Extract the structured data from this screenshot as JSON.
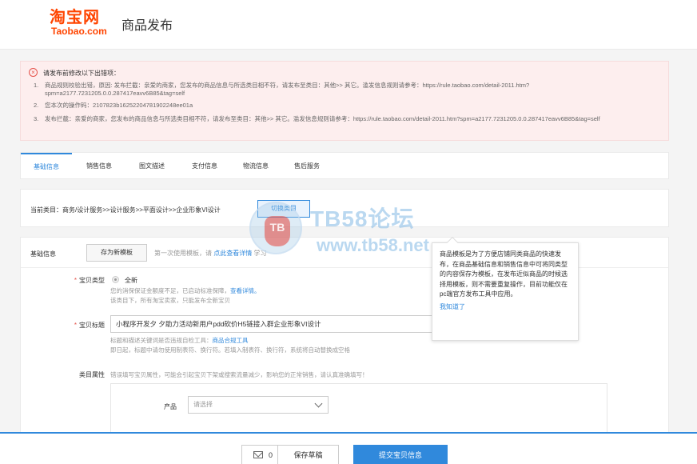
{
  "header": {
    "logo_main": "淘宝网",
    "logo_sub": "Taobao.com",
    "title": "商品发布"
  },
  "errors": {
    "icon": "error-circle-icon",
    "title": "请发布前修改以下出错项：",
    "items": [
      {
        "num": "1.",
        "text": "商品规则校验出错，原因: 发布拦截：亲爱的商家，您发布的商品信息与所选类目相不符，请发布至类目：其他>> 其它。滥发信息规则请参考：https://rule.taobao.com/detail-2011.htm?spm=a2177.7231205.0.0.287417eavv6B85&tag=self"
      },
      {
        "num": "2.",
        "text": "您本次的操作码：2107823b16252204781902248ee01a"
      },
      {
        "num": "3.",
        "text": "发布拦截：亲爱的商家，您发布的商品信息与所选类目相不符，请发布至类目：其他>> 其它。滥发信息规则请参考：https://rule.taobao.com/detail-2011.htm?spm=a2177.7231205.0.0.287417eavv6B85&tag=self"
      }
    ]
  },
  "tabs": [
    {
      "label": "基础信息",
      "active": true
    },
    {
      "label": "销售信息",
      "active": false
    },
    {
      "label": "图文描述",
      "active": false
    },
    {
      "label": "支付信息",
      "active": false
    },
    {
      "label": "物流信息",
      "active": false
    },
    {
      "label": "售后服务",
      "active": false
    }
  ],
  "category": {
    "text": "当前类目：商务/设计服务>>设计服务>>平面设计>>企业形象VI设计",
    "switch_label": "切换类目"
  },
  "watermark": {
    "hand_text": "TB",
    "title": "TB58论坛",
    "url": "www.tb58.net"
  },
  "form": {
    "section_label": "基础信息",
    "save_template_label": "存为新模板",
    "template_hint_prefix": "第一次使用模板，请",
    "template_hint_link": "点此查看详情",
    "template_hint_suffix": "学习",
    "item_type": {
      "label": "宝贝类型",
      "option": "全新",
      "hint_line1_prefix": "您的消保保证金额度不足，已启动标准保障，",
      "hint_line1_link": "查看详情。",
      "hint_line2": "该类目下，所有淘宝卖家，只能发布全新宝贝"
    },
    "item_title": {
      "label": "宝贝标题",
      "value": "小程序开发夕 夕助力活动新用户pdd砍价H5链接入群企业形象VI设计",
      "hint_line1_prefix": "标题和描述关键词是否违规自检工具：",
      "hint_line1_link": "商品合规工具",
      "hint_line2": "即日起，标题中请勿使用制表符、换行符。若填入制表符、换行符，系统将自动替换成空格"
    },
    "attributes": {
      "label": "类目属性",
      "hint": "错误填写宝贝属性，可能会引起宝贝下架或搜索流量减少，影响您的正常销售，请认真准确填写！",
      "product_label": "产品",
      "product_placeholder": "请选择"
    }
  },
  "popover": {
    "text": "商品模板是为了方便店铺同类商品的快速发布，在商品基础信息和销售信息中可将同类型的内容保存为模板，在发布近似商品的时候选择用模板，则不需要重复操作，目前功能仅在pc端官方发布工具中应用。",
    "link": "我知道了"
  },
  "footer": {
    "draft_icon": "mail-icon",
    "draft_count": "0",
    "save_draft_label": "保存草稿",
    "submit_label": "提交宝贝信息"
  },
  "colors": {
    "brand": "#ff4400",
    "accent": "#3089dc",
    "error": "#e5534b",
    "error_bg": "#fdeeee"
  }
}
